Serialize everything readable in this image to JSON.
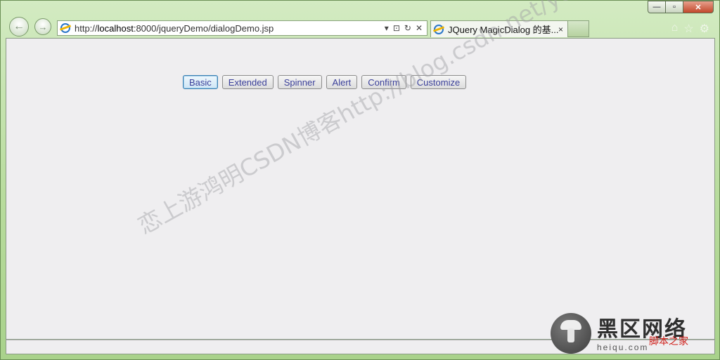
{
  "browser": {
    "address_url_prefix": "http://",
    "address_url_host": "localhost",
    "address_url_rest": ":8000/jqueryDemo/dialogDemo.jsp",
    "tab_title": "JQuery MagicDialog 的基...",
    "tab_close": "×",
    "addr_tools": [
      "▾",
      "⊡",
      "↻",
      "✕"
    ],
    "right_tools": [
      "⌂",
      "☆",
      "⚙"
    ],
    "window_controls": [
      "—",
      "▫",
      "✕"
    ]
  },
  "page": {
    "buttons": [
      "Basic",
      "Extended",
      "Spinner",
      "Alert",
      "Confirm",
      "Customize"
    ]
  },
  "watermark": "恋上游鸿明CSDN博客http://blog.csdn.net/youqishini",
  "logo": {
    "title": "黑区网络",
    "subtitle": "脚本之家",
    "url": "heiqu.com"
  }
}
